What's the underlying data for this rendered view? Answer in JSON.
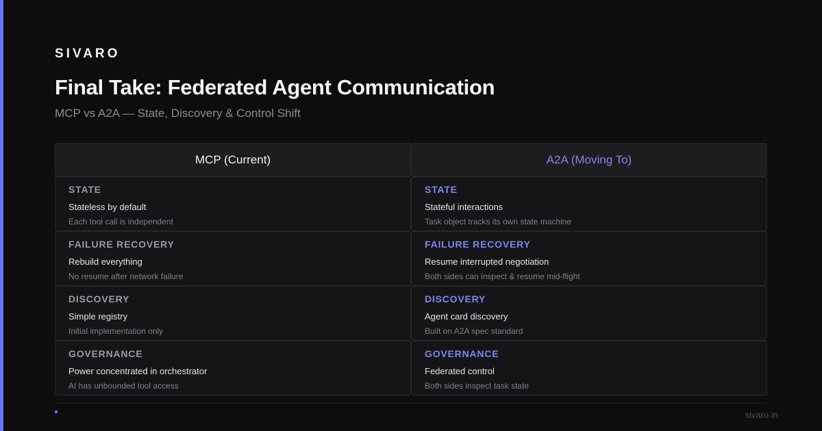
{
  "brand": "SIVARO",
  "title": "Final Take: Federated Agent Communication",
  "subtitle": "MCP vs A2A — State, Discovery & Control Shift",
  "colors": {
    "background": "#0d0d0d",
    "accent": "#6b74e6",
    "accent_text": "#7f86ef"
  },
  "table": {
    "headers": {
      "left": "MCP (Current)",
      "right": "A2A (Moving To)"
    },
    "rows": [
      {
        "left": {
          "label": "STATE",
          "primary": "Stateless by default",
          "secondary": "Each tool call is independent"
        },
        "right": {
          "label": "STATE",
          "primary": "Stateful interactions",
          "secondary": "Task object tracks its own state machine"
        }
      },
      {
        "left": {
          "label": "FAILURE RECOVERY",
          "primary": "Rebuild everything",
          "secondary": "No resume after network failure"
        },
        "right": {
          "label": "FAILURE RECOVERY",
          "primary": "Resume interrupted negotiation",
          "secondary": "Both sides can inspect & resume mid-flight"
        }
      },
      {
        "left": {
          "label": "DISCOVERY",
          "primary": "Simple registry",
          "secondary": "Initial implementation only"
        },
        "right": {
          "label": "DISCOVERY",
          "primary": "Agent card discovery",
          "secondary": "Built on A2A spec standard"
        }
      },
      {
        "left": {
          "label": "GOVERNANCE",
          "primary": "Power concentrated in orchestrator",
          "secondary": "AI has unbounded tool access"
        },
        "right": {
          "label": "GOVERNANCE",
          "primary": "Federated control",
          "secondary": "Both sides inspect task state"
        }
      }
    ]
  },
  "footer": {
    "url": "sivaro.in"
  }
}
